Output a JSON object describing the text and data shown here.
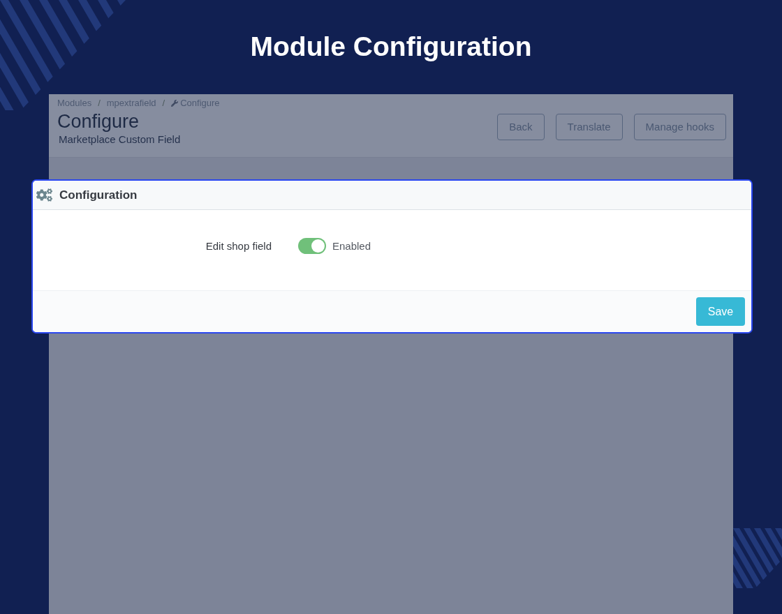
{
  "page": {
    "title": "Module Configuration"
  },
  "breadcrumb": [
    {
      "label": "Modules",
      "kind": "link",
      "separator": "/"
    },
    {
      "label": "mpextrafield",
      "kind": "link",
      "separator": "/"
    },
    {
      "label": "Configure",
      "kind": "current"
    }
  ],
  "header": {
    "title": "Configure",
    "subtitle": "Marketplace Custom Field",
    "buttons": [
      "Back",
      "Translate",
      "Manage hooks"
    ]
  },
  "config_panel": {
    "title": "Configuration",
    "fields": [
      {
        "kind": "switch",
        "label": "Edit shop field",
        "on": true,
        "state_label": "Enabled"
      }
    ],
    "save_button": "Save"
  }
}
